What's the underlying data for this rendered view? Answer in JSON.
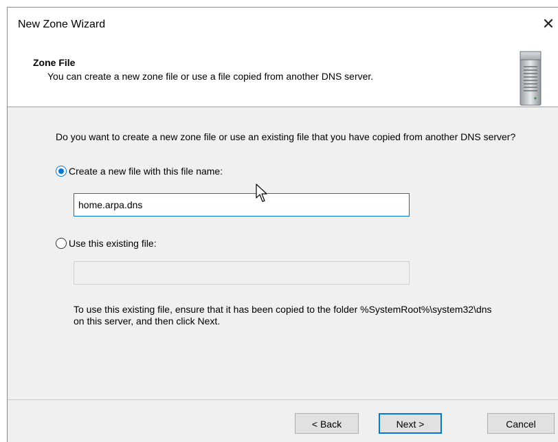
{
  "window": {
    "title": "New Zone Wizard",
    "close_glyph": "✕"
  },
  "header": {
    "title": "Zone File",
    "subtitle": "You can create a new zone file or use a file copied from another DNS server.",
    "icon": "server-icon"
  },
  "content": {
    "question": "Do you want to create a new zone file or use an existing file that you have copied from another DNS server?",
    "option_new": {
      "label": "Create a new file with this file name:",
      "selected": true,
      "value": "home.arpa.dns"
    },
    "option_existing": {
      "label": "Use this existing file:",
      "selected": false,
      "value": ""
    },
    "note": "To use this existing file, ensure that it has been copied to the folder %SystemRoot%\\system32\\dns on this server, and then click Next."
  },
  "buttons": {
    "back": "< Back",
    "next": "Next >",
    "cancel": "Cancel"
  },
  "colors": {
    "accent": "#0078d7",
    "panel": "#f0f0f0"
  }
}
